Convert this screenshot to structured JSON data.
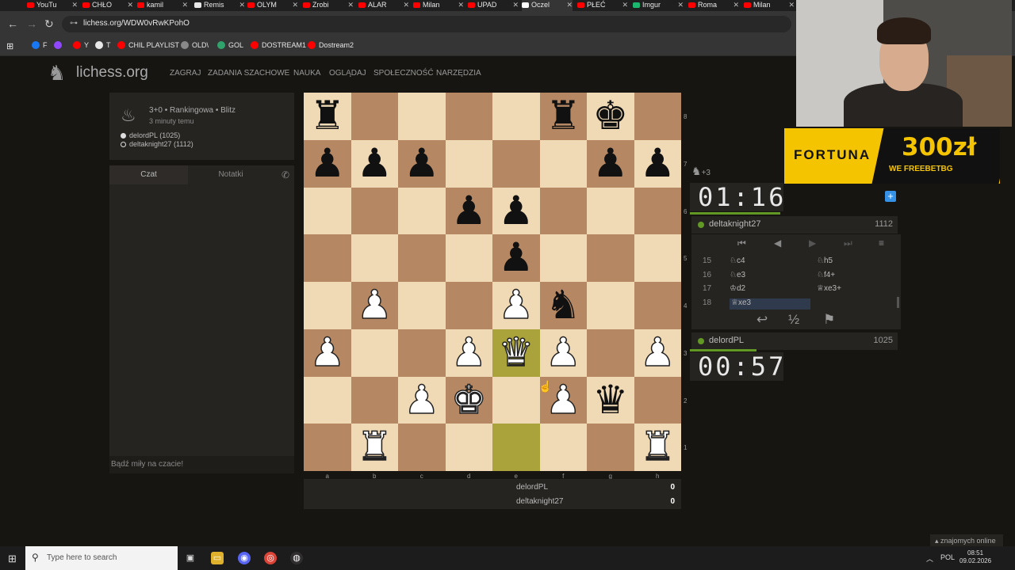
{
  "browser": {
    "tabs": [
      {
        "label": "YouTu",
        "color": "#ff0000"
      },
      {
        "label": "CHŁO",
        "color": "#ff0000"
      },
      {
        "label": "kamil",
        "color": "#ff0000"
      },
      {
        "label": "Remis",
        "color": "#e8e8e8"
      },
      {
        "label": "OLYM",
        "color": "#ff0000"
      },
      {
        "label": "Zrobi",
        "color": "#ff0000"
      },
      {
        "label": "ALAR",
        "color": "#ff0000"
      },
      {
        "label": "Milan",
        "color": "#ff0000"
      },
      {
        "label": "UPAD",
        "color": "#ff0000"
      },
      {
        "label": "Oczel",
        "color": "#ffffff",
        "active": true
      },
      {
        "label": "PŁEĆ",
        "color": "#ff0000"
      },
      {
        "label": "Imgur",
        "color": "#1bb76e"
      },
      {
        "label": "Roma",
        "color": "#ff0000"
      },
      {
        "label": "Milan",
        "color": "#ff0000"
      }
    ],
    "url": "lichess.org/WDW0vRwKPohO",
    "bookmarks": [
      {
        "label": "F",
        "color": "#1877f2"
      },
      {
        "label": "",
        "color": "#9146ff"
      },
      {
        "label": "Y",
        "color": "#ff0000"
      },
      {
        "label": "T",
        "color": "#e8e8e8"
      },
      {
        "label": "CHIL PLAYLIST",
        "color": "#ff0000"
      },
      {
        "label": "OLD\\",
        "color": "#888888"
      },
      {
        "label": "GOL",
        "color": "#2fa36b"
      },
      {
        "label": "DOSTREAM1",
        "color": "#ff0000"
      },
      {
        "label": "Dostream2",
        "color": "#ff0000"
      }
    ]
  },
  "site": {
    "logo": "lichess.org",
    "nav": [
      "ZAGRAJ",
      "ZADANIA SZACHOWE",
      "NAUKA",
      "OGLĄDAJ",
      "SPOŁECZNOŚĆ",
      "NARZĘDZIA"
    ]
  },
  "game": {
    "meta": "3+0 • Rankingowa • Blitz",
    "ago": "3 minuty temu",
    "white": "delordPL (1025)",
    "black": "deltaknight27 (1112)"
  },
  "chat": {
    "tabs": [
      "Czat",
      "Notatki"
    ],
    "placeholder": "Bądź miły na czacie!"
  },
  "board": {
    "files": [
      "a",
      "b",
      "c",
      "d",
      "e",
      "f",
      "g",
      "h"
    ],
    "ranks": [
      "8",
      "7",
      "6",
      "5",
      "4",
      "3",
      "2",
      "1"
    ],
    "highlight": [
      "e3",
      "e1"
    ],
    "pieces": [
      {
        "sq": "a8",
        "p": "rook",
        "c": "b"
      },
      {
        "sq": "f8",
        "p": "rook",
        "c": "b"
      },
      {
        "sq": "g8",
        "p": "king",
        "c": "b"
      },
      {
        "sq": "a7",
        "p": "pawn",
        "c": "b"
      },
      {
        "sq": "b7",
        "p": "pawn",
        "c": "b"
      },
      {
        "sq": "c7",
        "p": "pawn",
        "c": "b"
      },
      {
        "sq": "g7",
        "p": "pawn",
        "c": "b"
      },
      {
        "sq": "h7",
        "p": "pawn",
        "c": "b"
      },
      {
        "sq": "d6",
        "p": "pawn",
        "c": "b"
      },
      {
        "sq": "e6",
        "p": "pawn",
        "c": "b"
      },
      {
        "sq": "e5",
        "p": "pawn",
        "c": "b"
      },
      {
        "sq": "b4",
        "p": "pawn",
        "c": "w"
      },
      {
        "sq": "e4",
        "p": "pawn",
        "c": "w"
      },
      {
        "sq": "f4",
        "p": "knight",
        "c": "b"
      },
      {
        "sq": "a3",
        "p": "pawn",
        "c": "w"
      },
      {
        "sq": "d3",
        "p": "pawn",
        "c": "w"
      },
      {
        "sq": "e3",
        "p": "queen",
        "c": "w"
      },
      {
        "sq": "f3",
        "p": "pawn",
        "c": "w"
      },
      {
        "sq": "h3",
        "p": "pawn",
        "c": "w"
      },
      {
        "sq": "c2",
        "p": "pawn",
        "c": "w"
      },
      {
        "sq": "d2",
        "p": "king",
        "c": "w"
      },
      {
        "sq": "f2",
        "p": "pawn",
        "c": "w"
      },
      {
        "sq": "g2",
        "p": "queen",
        "c": "b"
      },
      {
        "sq": "b1",
        "p": "rook",
        "c": "w"
      },
      {
        "sq": "h1",
        "p": "rook",
        "c": "w"
      }
    ]
  },
  "score": [
    {
      "name": "delordPL",
      "value": "0"
    },
    {
      "name": "deltaknight27",
      "value": "0"
    }
  ],
  "right": {
    "captured": "+3",
    "top_clock": "01:16",
    "top_player": "deltaknight27",
    "top_rating": "1112",
    "bottom_clock": "00:57",
    "bottom_player": "delordPL",
    "bottom_rating": "1025",
    "moves": [
      {
        "n": "15",
        "w": "♘c4",
        "b": "♘h5"
      },
      {
        "n": "16",
        "w": "♘e3",
        "b": "♘f4+"
      },
      {
        "n": "17",
        "w": "♔d2",
        "b": "♕xe3+"
      },
      {
        "n": "18",
        "w": "♕xe3",
        "b": ""
      }
    ]
  },
  "ad": {
    "brand": "FORTUNA",
    "amount": "300zł",
    "promo": "WE FREEBETBG"
  },
  "friends": "znajomych online",
  "taskbar": {
    "search": "Type here to search",
    "lang": "POL",
    "time": "08:51",
    "date": "09.02.2026"
  }
}
